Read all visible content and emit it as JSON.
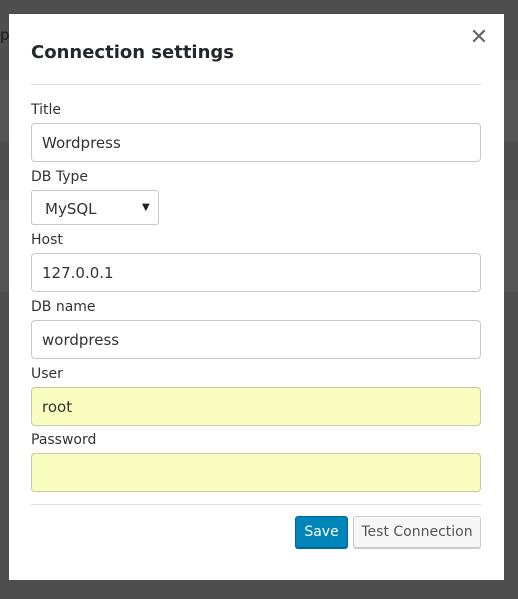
{
  "background": {
    "partial_char": "p"
  },
  "dialog": {
    "title": "Connection settings",
    "close_icon": "close-icon",
    "close_glyph": "✕"
  },
  "form": {
    "title": {
      "label": "Title",
      "value": "Wordpress"
    },
    "db_type": {
      "label": "DB Type",
      "selected": "MySQL",
      "arrow_glyph": "▼"
    },
    "host": {
      "label": "Host",
      "value": "127.0.0.1"
    },
    "db_name": {
      "label": "DB name",
      "value": "wordpress"
    },
    "user": {
      "label": "User",
      "value": "root"
    },
    "password": {
      "label": "Password",
      "value": ""
    }
  },
  "actions": {
    "save_label": "Save",
    "test_label": "Test Connection"
  },
  "colors": {
    "primary_button": "#0085ba",
    "autofill_background": "#fafdc0",
    "overlay": "#4e4e4e"
  }
}
